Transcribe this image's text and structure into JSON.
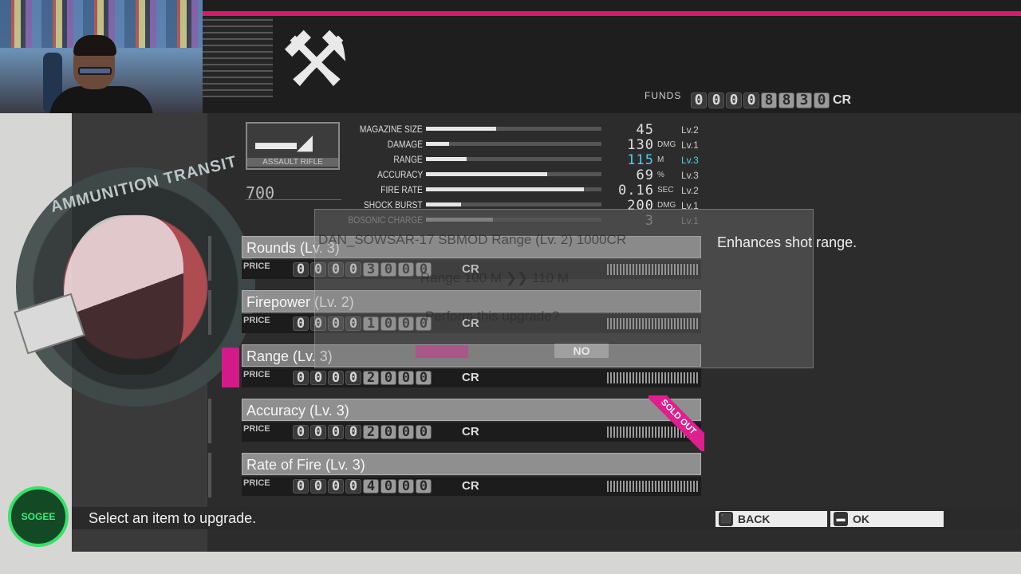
{
  "header": {
    "tools_glyph": "⚒",
    "funds_label": "FUNDS",
    "funds_digits": [
      "0",
      "0",
      "0",
      "0",
      "8",
      "8",
      "3",
      "0"
    ],
    "funds_active_from": 4,
    "funds_currency": "CR"
  },
  "emblem": {
    "text": "AMMUNITION TRANSIT"
  },
  "weapon": {
    "category": "ASSAULT RIFLE",
    "cost": "700",
    "icon": "rifle-icon"
  },
  "stats": [
    {
      "name": "MAGAZINE SIZE",
      "value": "45",
      "unit": "",
      "level": "Lv.2",
      "fill": 0.4
    },
    {
      "name": "DAMAGE",
      "value": "130",
      "unit": "DMG",
      "level": "Lv.1",
      "fill": 0.13
    },
    {
      "name": "RANGE",
      "value": "115",
      "unit": "M",
      "level": "Lv.3",
      "fill": 0.23,
      "highlight": true
    },
    {
      "name": "ACCURACY",
      "value": "69",
      "unit": "%",
      "level": "Lv.3",
      "fill": 0.69
    },
    {
      "name": "FIRE RATE",
      "value": "0.16",
      "unit": "SEC",
      "level": "Lv.2",
      "fill": 0.9
    },
    {
      "name": "SHOCK BURST",
      "value": "200",
      "unit": "DMG",
      "level": "Lv.1",
      "fill": 0.2
    },
    {
      "name": "BOSONIC CHARGE",
      "value": "3",
      "unit": "",
      "level": "Lv.1",
      "fill": 0.38,
      "dim": true
    }
  ],
  "upgrades": [
    {
      "name": "Rounds (Lv. 3)",
      "price_label": "PRICE",
      "digits": [
        "0",
        "0",
        "0",
        "0",
        "3",
        "0",
        "0",
        "0"
      ],
      "active_from": 4,
      "currency": "CR",
      "sold_out": false,
      "selected": false
    },
    {
      "name": "Firepower (Lv. 2)",
      "price_label": "PRICE",
      "digits": [
        "0",
        "0",
        "0",
        "0",
        "1",
        "0",
        "0",
        "0"
      ],
      "active_from": 4,
      "currency": "CR",
      "sold_out": false,
      "selected": false
    },
    {
      "name": "Range (Lv. 3)",
      "price_label": "PRICE",
      "digits": [
        "0",
        "0",
        "0",
        "0",
        "2",
        "0",
        "0",
        "0"
      ],
      "active_from": 4,
      "currency": "CR",
      "sold_out": false,
      "selected": true
    },
    {
      "name": "Accuracy (Lv. 3)",
      "price_label": "PRICE",
      "digits": [
        "0",
        "0",
        "0",
        "0",
        "2",
        "0",
        "0",
        "0"
      ],
      "active_from": 4,
      "currency": "CR",
      "sold_out": true,
      "sold_out_label": "SOLD OUT",
      "selected": false
    },
    {
      "name": "Rate of Fire (Lv. 3)",
      "price_label": "PRICE",
      "digits": [
        "0",
        "0",
        "0",
        "0",
        "4",
        "0",
        "0",
        "0"
      ],
      "active_from": 4,
      "currency": "CR",
      "sold_out": false,
      "selected": false
    }
  ],
  "dialog": {
    "title": "DAN_SOWSAR-17 SBMOD Range (Lv. 2) 1000CR",
    "detail": "Range 100 M ❯❯ 110 M",
    "question": "Perform this upgrade?",
    "yes_label": "",
    "no_label": "NO"
  },
  "description": "Enhances shot range.",
  "footer": {
    "hint": "Select an item to upgrade.",
    "back_label": "BACK",
    "back_key": "⬛",
    "ok_label": "OK",
    "ok_key": "▬"
  },
  "logo": {
    "text": "SOGEE"
  }
}
